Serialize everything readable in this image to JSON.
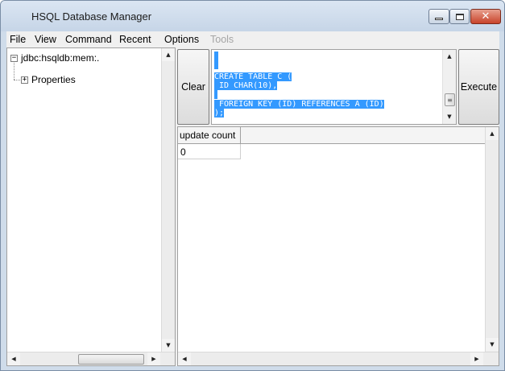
{
  "window": {
    "title": "HSQL Database Manager"
  },
  "menu": {
    "items": [
      {
        "label": "File",
        "enabled": true
      },
      {
        "label": "View",
        "enabled": true
      },
      {
        "label": "Command",
        "enabled": true
      },
      {
        "label": "Recent",
        "enabled": true
      },
      {
        "label": "Options",
        "enabled": true
      },
      {
        "label": "Tools",
        "enabled": false
      }
    ]
  },
  "tree": {
    "root": {
      "label": "jdbc:hsqldb:mem:.",
      "toggle": "−"
    },
    "children": [
      {
        "label": "Properties",
        "toggle": "+"
      }
    ]
  },
  "command": {
    "clear_label": "Clear",
    "execute_label": "Execute",
    "sql_lines": [
      "CREATE TABLE C (",
      " ID CHAR(10),",
      "",
      " FOREIGN KEY (ID) REFERENCES A (ID)",
      ");"
    ]
  },
  "results": {
    "columns": [
      "update count"
    ],
    "rows": [
      [
        "0"
      ]
    ]
  },
  "colors": {
    "selection": "#3399ff",
    "title_bar": "#cfdcea",
    "close_button": "#c8432a"
  }
}
